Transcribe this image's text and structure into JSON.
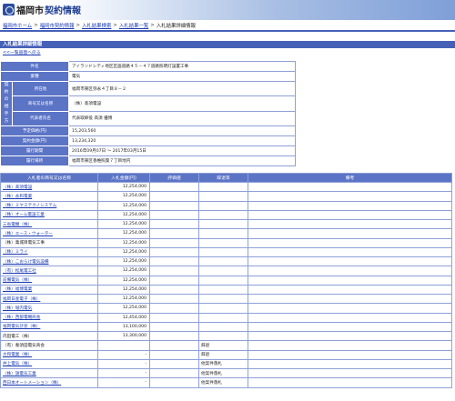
{
  "logo": {
    "city": "福岡市",
    "system": "契約情報"
  },
  "breadcrumb": [
    {
      "label": "福岡市ホーム",
      "link": true
    },
    {
      "label": "福岡市契約情報",
      "link": true
    },
    {
      "label": "入札結果検索",
      "link": true
    },
    {
      "label": "入札結果一覧",
      "link": true
    },
    {
      "label": "入札結果詳細情報",
      "link": false
    }
  ],
  "breadcrumb_sep": ">",
  "section_title": "入札結果詳細情報",
  "back_link": "<<一覧画面へ戻る",
  "detail": {
    "side_label": "契約の相手方",
    "rows": {
      "name": {
        "label": "件名",
        "value": "アイランドシティ地区区画道路４５－４７道路照明灯設置工事"
      },
      "type": {
        "label": "業種",
        "value": "電気"
      },
      "address": {
        "label": "所在地",
        "value": "福岡市東区弥永４丁目８－２"
      },
      "company": {
        "label": "商号又は名称",
        "value": "（株）髙須電設"
      },
      "rep": {
        "label": "代表者氏名",
        "value": "代表取締役 髙須 優博"
      },
      "est": {
        "label": "予定価格(円)",
        "value": "15,203,560"
      },
      "contract": {
        "label": "契約金額(円)",
        "value": "13,234,320"
      },
      "period": {
        "label": "履行期間",
        "value": "2016年09月07日 ～ 2017年03月15日"
      },
      "place": {
        "label": "履行場所",
        "value": "福岡市東区香椎照葉７丁目地内"
      }
    }
  },
  "results": {
    "headers": [
      "入札者の商号又は名称",
      "入札金額(円)",
      "評価値",
      "辞退等",
      "備考"
    ],
    "rows": [
      {
        "name": "（株）髙須電設",
        "amount": "12,254,000",
        "eval": "",
        "status": "",
        "note": "",
        "link": true
      },
      {
        "name": "（株）永和電業",
        "amount": "12,254,000",
        "eval": "",
        "status": "",
        "note": "",
        "link": true
      },
      {
        "name": "（株）ミヤステクノシステム",
        "amount": "12,254,000",
        "eval": "",
        "status": "",
        "note": "",
        "link": true
      },
      {
        "name": "（株）オーム電設工業",
        "amount": "12,254,000",
        "eval": "",
        "status": "",
        "note": "",
        "link": true
      },
      {
        "name": "三省電機（株）",
        "amount": "12,254,000",
        "eval": "",
        "status": "",
        "note": "",
        "link": true
      },
      {
        "name": "（株）エース・ウォーター",
        "amount": "12,254,000",
        "eval": "",
        "status": "",
        "note": "",
        "link": true
      },
      {
        "name": "（株）萬城目電気工事",
        "amount": "12,254,000",
        "eval": "",
        "status": "",
        "note": "",
        "link": false
      },
      {
        "name": "（株）ミライ",
        "amount": "12,254,000",
        "eval": "",
        "status": "",
        "note": "",
        "link": true
      },
      {
        "name": "（株）こおらけ電気設備",
        "amount": "12,254,000",
        "eval": "",
        "status": "",
        "note": "",
        "link": true
      },
      {
        "name": "（有）松尾電工社",
        "amount": "12,254,000",
        "eval": "",
        "status": "",
        "note": "",
        "link": true
      },
      {
        "name": "前備電気（株）",
        "amount": "12,254,000",
        "eval": "",
        "status": "",
        "note": "",
        "link": true
      },
      {
        "name": "（株）福博電業",
        "amount": "12,254,000",
        "eval": "",
        "status": "",
        "note": "",
        "link": true
      },
      {
        "name": "福岡日産電子（株）",
        "amount": "12,254,000",
        "eval": "",
        "status": "",
        "note": "",
        "link": true
      },
      {
        "name": "（株）堀内電気",
        "amount": "12,254,000",
        "eval": "",
        "status": "",
        "note": "",
        "link": true
      },
      {
        "name": "（株）西部電機商会",
        "amount": "12,454,000",
        "eval": "",
        "status": "",
        "note": "",
        "link": true
      },
      {
        "name": "福岡電気計装（株）",
        "amount": "13,100,000",
        "eval": "",
        "status": "",
        "note": "",
        "link": true
      },
      {
        "name": "内田電工（株）",
        "amount": "13,300,000",
        "eval": "",
        "status": "",
        "note": "",
        "link": false
      },
      {
        "name": "（有）秦須田電気商会",
        "amount": "",
        "eval": "",
        "status": "辞退",
        "note": "",
        "link": false
      },
      {
        "name": "大和電業（株）",
        "amount": "-",
        "eval": "",
        "status": "辞退",
        "note": "",
        "link": true
      },
      {
        "name": "井上電気（株）",
        "amount": "-",
        "eval": "",
        "status": "他案件落札",
        "note": "",
        "link": true
      },
      {
        "name": "（株）旗電気工業",
        "amount": "-",
        "eval": "",
        "status": "他案件落札",
        "note": "",
        "link": true
      },
      {
        "name": "西日本オートメーション（株）",
        "amount": "-",
        "eval": "",
        "status": "他案件落札",
        "note": "",
        "link": true
      }
    ]
  },
  "colors": {
    "header_blue": "#4660b8",
    "label_blue": "#5b74c6",
    "link": "#1a3bb3"
  }
}
